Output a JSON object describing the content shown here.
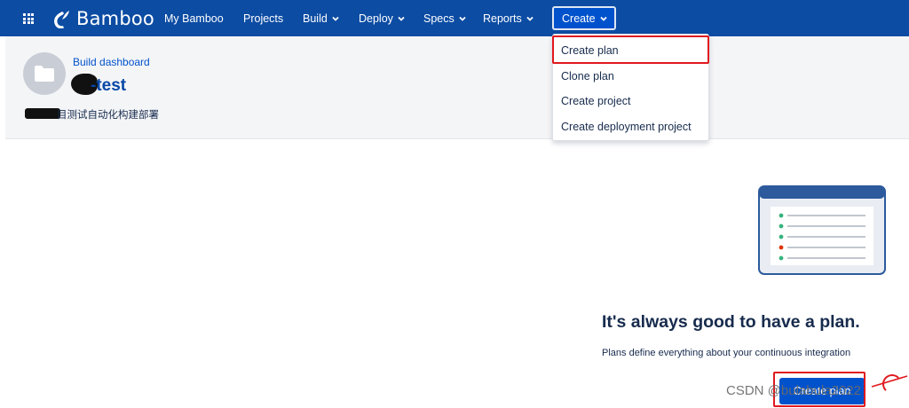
{
  "topnav": {
    "logo_text": "Bamboo",
    "items": [
      {
        "label": "My Bamboo"
      },
      {
        "label": "Projects"
      },
      {
        "label": "Build"
      },
      {
        "label": "Deploy"
      },
      {
        "label": "Specs"
      },
      {
        "label": "Reports"
      }
    ],
    "create_label": "Create"
  },
  "header": {
    "breadcrumb": "Build dashboard",
    "title": "-test",
    "description": "目测试自动化构建部署"
  },
  "create_menu": {
    "items": [
      {
        "label": "Create plan"
      },
      {
        "label": "Clone plan"
      },
      {
        "label": "Create project"
      },
      {
        "label": "Create deployment project"
      }
    ]
  },
  "empty_state": {
    "title": "It's always good to have a plan.",
    "subtitle": "Plans define everything about your continuous integration",
    "button_label": "Create plan"
  },
  "watermark": "CSDN @bulabula2022",
  "colors": {
    "nav_bg": "#0c4ca3",
    "accent": "#0052cc",
    "highlight": "#e0181f"
  }
}
